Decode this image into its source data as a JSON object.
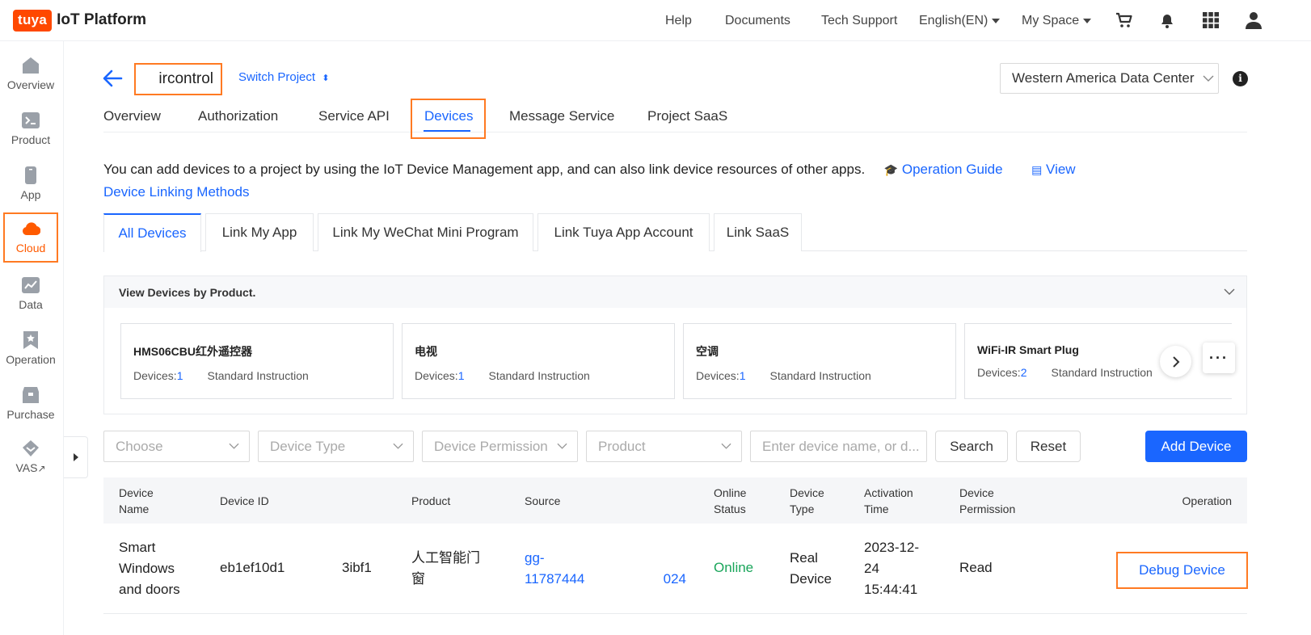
{
  "topbar": {
    "logo_brand": "tuya",
    "logo_text": "IoT Platform",
    "nav": [
      "Help",
      "Documents",
      "Tech Support",
      "English(EN)",
      "My Space"
    ],
    "icons": [
      "cart-icon",
      "bell-icon",
      "apps-grid-icon",
      "user-icon"
    ]
  },
  "sidebar": {
    "items": [
      {
        "label": "Overview",
        "icon": "home-icon"
      },
      {
        "label": "Product",
        "icon": "terminal-icon"
      },
      {
        "label": "App",
        "icon": "phone-icon"
      },
      {
        "label": "Cloud",
        "icon": "cloud-icon",
        "active": true
      },
      {
        "label": "Data",
        "icon": "chart-icon"
      },
      {
        "label": "Operation",
        "icon": "bookmark-star-icon"
      },
      {
        "label": "Purchase",
        "icon": "store-icon"
      },
      {
        "label": "VAS",
        "icon": "diamond-icon"
      }
    ]
  },
  "project": {
    "name": "ircontrol",
    "switch_label": "Switch Project",
    "data_center": "Western America Data Center"
  },
  "tabs": [
    "Overview",
    "Authorization",
    "Service API",
    "Devices",
    "Message Service",
    "Project SaaS"
  ],
  "active_tab": "Devices",
  "description": {
    "text": "You can add devices to a project by using the IoT Device Management app, and can also link device resources of other apps.",
    "guide_link": "Operation Guide",
    "view_link_1": "View",
    "view_link_2": "Device Linking Methods"
  },
  "subtabs": [
    "All Devices",
    "Link My App",
    "Link My WeChat Mini Program",
    "Link Tuya App Account",
    "Link SaaS"
  ],
  "products_panel": {
    "title": "View Devices by Product.",
    "devices_label": "Devices:",
    "cards": [
      {
        "name": "HMS06CBU红外遥控器",
        "count": "1",
        "type": "Standard Instruction"
      },
      {
        "name": "电视",
        "count": "1",
        "type": "Standard Instruction"
      },
      {
        "name": "空调",
        "count": "1",
        "type": "Standard Instruction"
      },
      {
        "name": "WiFi-IR Smart Plug",
        "count": "2",
        "type": "Standard Instruction"
      }
    ],
    "more_label": "···"
  },
  "filters": {
    "choose": "Choose",
    "device_type": "Device Type",
    "device_permission": "Device Permission",
    "product": "Product",
    "search_placeholder": "Enter device name, or d...",
    "search_btn": "Search",
    "reset_btn": "Reset",
    "add_btn": "Add Device"
  },
  "table": {
    "headers": {
      "device_name": "Device Name",
      "device_id": "Device ID",
      "product": "Product",
      "source": "Source",
      "online_status": "Online Status",
      "device_type": "Device Type",
      "activation_time": "Activation Time",
      "device_permission": "Device Permission",
      "operation": "Operation"
    },
    "rows": [
      {
        "device_name": "Smart Windows and doors",
        "device_id_a": "eb1ef10d1",
        "device_id_b": "3ibf1",
        "product": "人工智能门窗",
        "source_a": "gg-11787444",
        "source_b": "024",
        "online_status": "Online",
        "device_type": "Real Device",
        "activation_time": "2023-12-24 15:44:41",
        "device_permission": "Read",
        "operation": "Debug Device"
      }
    ]
  },
  "colors": {
    "brand": "#ff4800",
    "accent": "#1a66ff",
    "highlight": "#ff7a22",
    "online": "#19a55a"
  }
}
